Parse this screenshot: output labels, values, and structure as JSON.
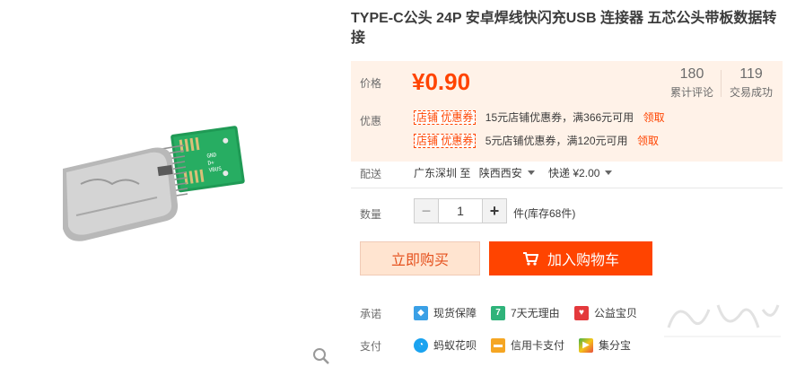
{
  "product": {
    "title": "TYPE-C公头 24P 安卓焊线快闪充USB 连接器 五芯公头带板数据转接"
  },
  "price": {
    "label": "价格",
    "value": "¥0.90",
    "stats": [
      {
        "num": "180",
        "caption": "累计评论"
      },
      {
        "num": "119",
        "caption": "交易成功"
      }
    ]
  },
  "coupons": {
    "label": "优惠",
    "items": [
      {
        "tag": "店铺 优惠券",
        "text": "15元店铺优惠券，满366元可用",
        "link": "领取"
      },
      {
        "tag": "店铺 优惠券",
        "text": "5元店铺优惠券，满120元可用",
        "link": "领取"
      }
    ]
  },
  "delivery": {
    "label": "配送",
    "from": "广东深圳 至",
    "to": "陕西西安",
    "shipping": "快递 ¥2.00"
  },
  "quantity": {
    "label": "数量",
    "value": "1",
    "minus": "−",
    "plus": "+",
    "stock": "件(库存68件)"
  },
  "buttons": {
    "buy_now": "立即购买",
    "add_cart": "加入购物车"
  },
  "promises": {
    "label": "承诺",
    "items": [
      "现货保障",
      "7天无理由",
      "公益宝贝"
    ]
  },
  "payment": {
    "label": "支付",
    "items": [
      "蚂蚁花呗",
      "信用卡支付",
      "集分宝"
    ]
  },
  "colors": {
    "accent": "#ff4400",
    "panel_bg": "#fff2e8",
    "buy_now_bg": "#ffe4d0"
  }
}
